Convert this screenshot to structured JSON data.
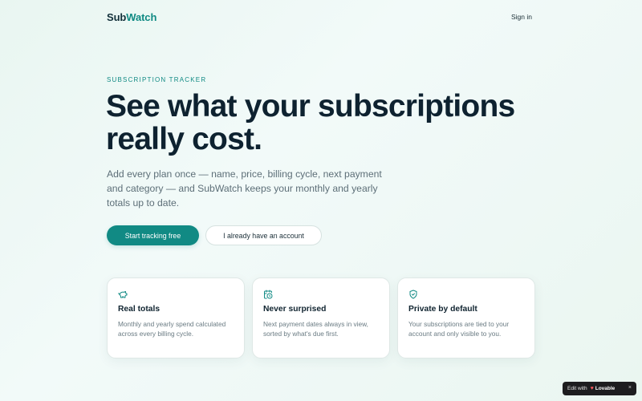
{
  "header": {
    "logo_part1": "Sub",
    "logo_part2": "Watch",
    "signin_label": "Sign in"
  },
  "hero": {
    "eyebrow": "SUBSCRIPTION TRACKER",
    "headline_line1": "See what your subscriptions",
    "headline_line2": "really cost.",
    "subtitle": "Add every plan once — name, price, billing cycle, next payment and category — and SubWatch keeps your monthly and yearly totals up to date.",
    "primary_button": "Start tracking free",
    "secondary_button": "I already have an account"
  },
  "features": [
    {
      "icon": "piggy-bank-icon",
      "title": "Real totals",
      "description": "Monthly and yearly spend calculated across every billing cycle."
    },
    {
      "icon": "calendar-clock-icon",
      "title": "Never surprised",
      "description": "Next payment dates always in view, sorted by what's due first."
    },
    {
      "icon": "shield-check-icon",
      "title": "Private by default",
      "description": "Your subscriptions are tied to your account and only visible to you."
    }
  ],
  "badge": {
    "prefix": "Edit with",
    "brand": "Lovable",
    "close": "×"
  },
  "colors": {
    "accent": "#118a84",
    "heading": "#0e2230",
    "muted": "#5d6f78"
  }
}
